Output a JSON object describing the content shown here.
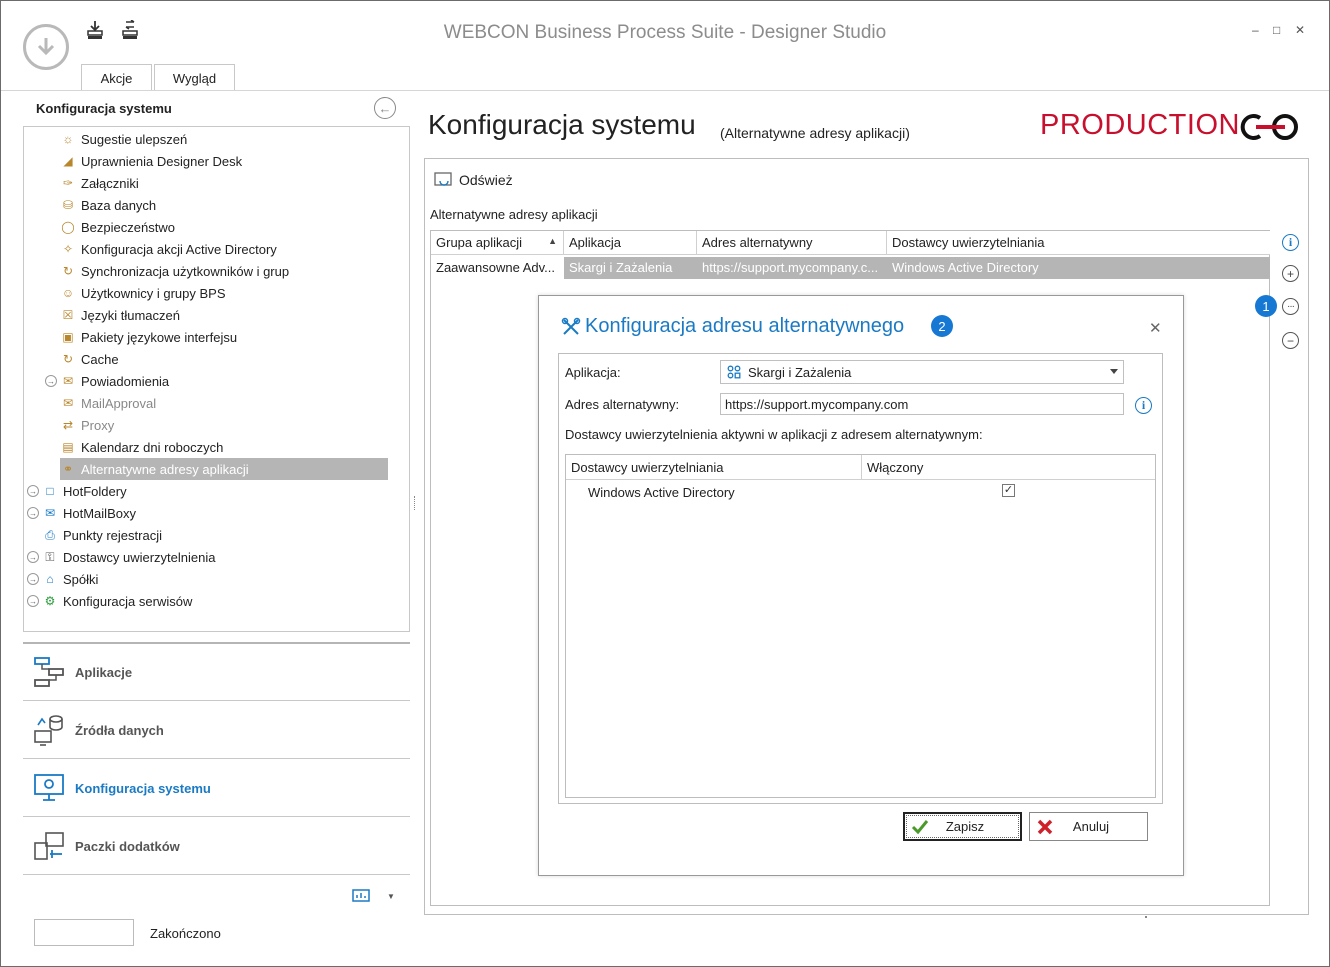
{
  "window": {
    "title": "WEBCON Business Process Suite - Designer Studio",
    "minimize": "–",
    "maximize": "□",
    "close": "✕"
  },
  "ribbon": {
    "tabs": [
      {
        "label": "Akcje"
      },
      {
        "label": "Wygląd"
      }
    ]
  },
  "left_panel": {
    "title": "Konfiguracja systemu",
    "tree": [
      {
        "label": "Sugestie ulepszeń",
        "icon": "lightbulb-icon"
      },
      {
        "label": "Uprawnienia Designer Desk",
        "icon": "ruler-icon"
      },
      {
        "label": "Załączniki",
        "icon": "paperclip-icon"
      },
      {
        "label": "Baza danych",
        "icon": "database-icon"
      },
      {
        "label": "Bezpieczeństwo",
        "icon": "shield-icon"
      },
      {
        "label": "Konfiguracja akcji Active Directory",
        "icon": "directory-icon"
      },
      {
        "label": "Synchronizacja użytkowników i grup",
        "icon": "sync-users-icon"
      },
      {
        "label": "Użytkownicy i grupy BPS",
        "icon": "users-icon"
      },
      {
        "label": "Języki tłumaczeń",
        "icon": "translate-icon"
      },
      {
        "label": "Pakiety językowe interfejsu",
        "icon": "language-pack-icon"
      },
      {
        "label": "Cache",
        "icon": "refresh-icon"
      },
      {
        "label": "Powiadomienia",
        "icon": "envelope-icon"
      },
      {
        "label": "MailApproval",
        "icon": "mail-approval-icon"
      },
      {
        "label": "Proxy",
        "icon": "proxy-icon"
      },
      {
        "label": "Kalendarz dni roboczych",
        "icon": "calendar-icon"
      },
      {
        "label": "Alternatywne adresy aplikacji",
        "icon": "globe-icon"
      },
      {
        "label": "HotFoldery",
        "icon": "hotfolder-icon"
      },
      {
        "label": "HotMailBoxy",
        "icon": "hotmailbox-icon"
      },
      {
        "label": "Punkty rejestracji",
        "icon": "printer-icon"
      },
      {
        "label": "Dostawcy uwierzytelnienia",
        "icon": "key-icon"
      },
      {
        "label": "Spółki",
        "icon": "house-icon"
      },
      {
        "label": "Konfiguracja serwisów",
        "icon": "gear-icon"
      }
    ],
    "nav": [
      {
        "label": "Aplikacje",
        "icon": "applications-icon"
      },
      {
        "label": "Źródła danych",
        "icon": "data-sources-icon"
      },
      {
        "label": "Konfiguracja systemu",
        "icon": "system-config-icon"
      },
      {
        "label": "Paczki dodatków",
        "icon": "addon-packages-icon"
      }
    ]
  },
  "status": {
    "text": "Zakończono"
  },
  "main": {
    "title": "Konfiguracja systemu",
    "subtitle": "(Alternatywne adresy aplikacji)",
    "environment": "PRODUCTION",
    "refresh_label": "Odśwież",
    "grid_label": "Alternatywne adresy aplikacji",
    "grid": {
      "columns": [
        "Grupa aplikacji",
        "Aplikacja",
        "Adres alternatywny",
        "Dostawcy uwierzytelniania"
      ],
      "rows": [
        [
          "Zaawansowne Adv...",
          "Skargi i Zażalenia",
          "https://support.mycompany.c...",
          "Windows Active Directory"
        ]
      ]
    },
    "badge_1": "1"
  },
  "dialog": {
    "title": "Konfiguracja adresu alternatywnego",
    "badge": "2",
    "close": "✕",
    "application_label": "Aplikacja:",
    "application_value": "Skargi i Zażalenia",
    "alt_address_label": "Adres alternatywny:",
    "alt_address_value": "https://support.mycompany.com",
    "providers_label": "Dostawcy uwierzytelnienia aktywni w aplikacji z adresem alternatywnym:",
    "providers_grid": {
      "columns": [
        "Dostawcy uwierzytelniania",
        "Włączony"
      ],
      "rows": [
        {
          "name": "Windows Active Directory",
          "enabled": true
        }
      ]
    },
    "save_label": "Zapisz",
    "cancel_label": "Anuluj"
  },
  "colors": {
    "accent": "#1a7ac4",
    "production": "#c8102e",
    "selection": "#b5b5b5",
    "badge": "#1778d4"
  }
}
